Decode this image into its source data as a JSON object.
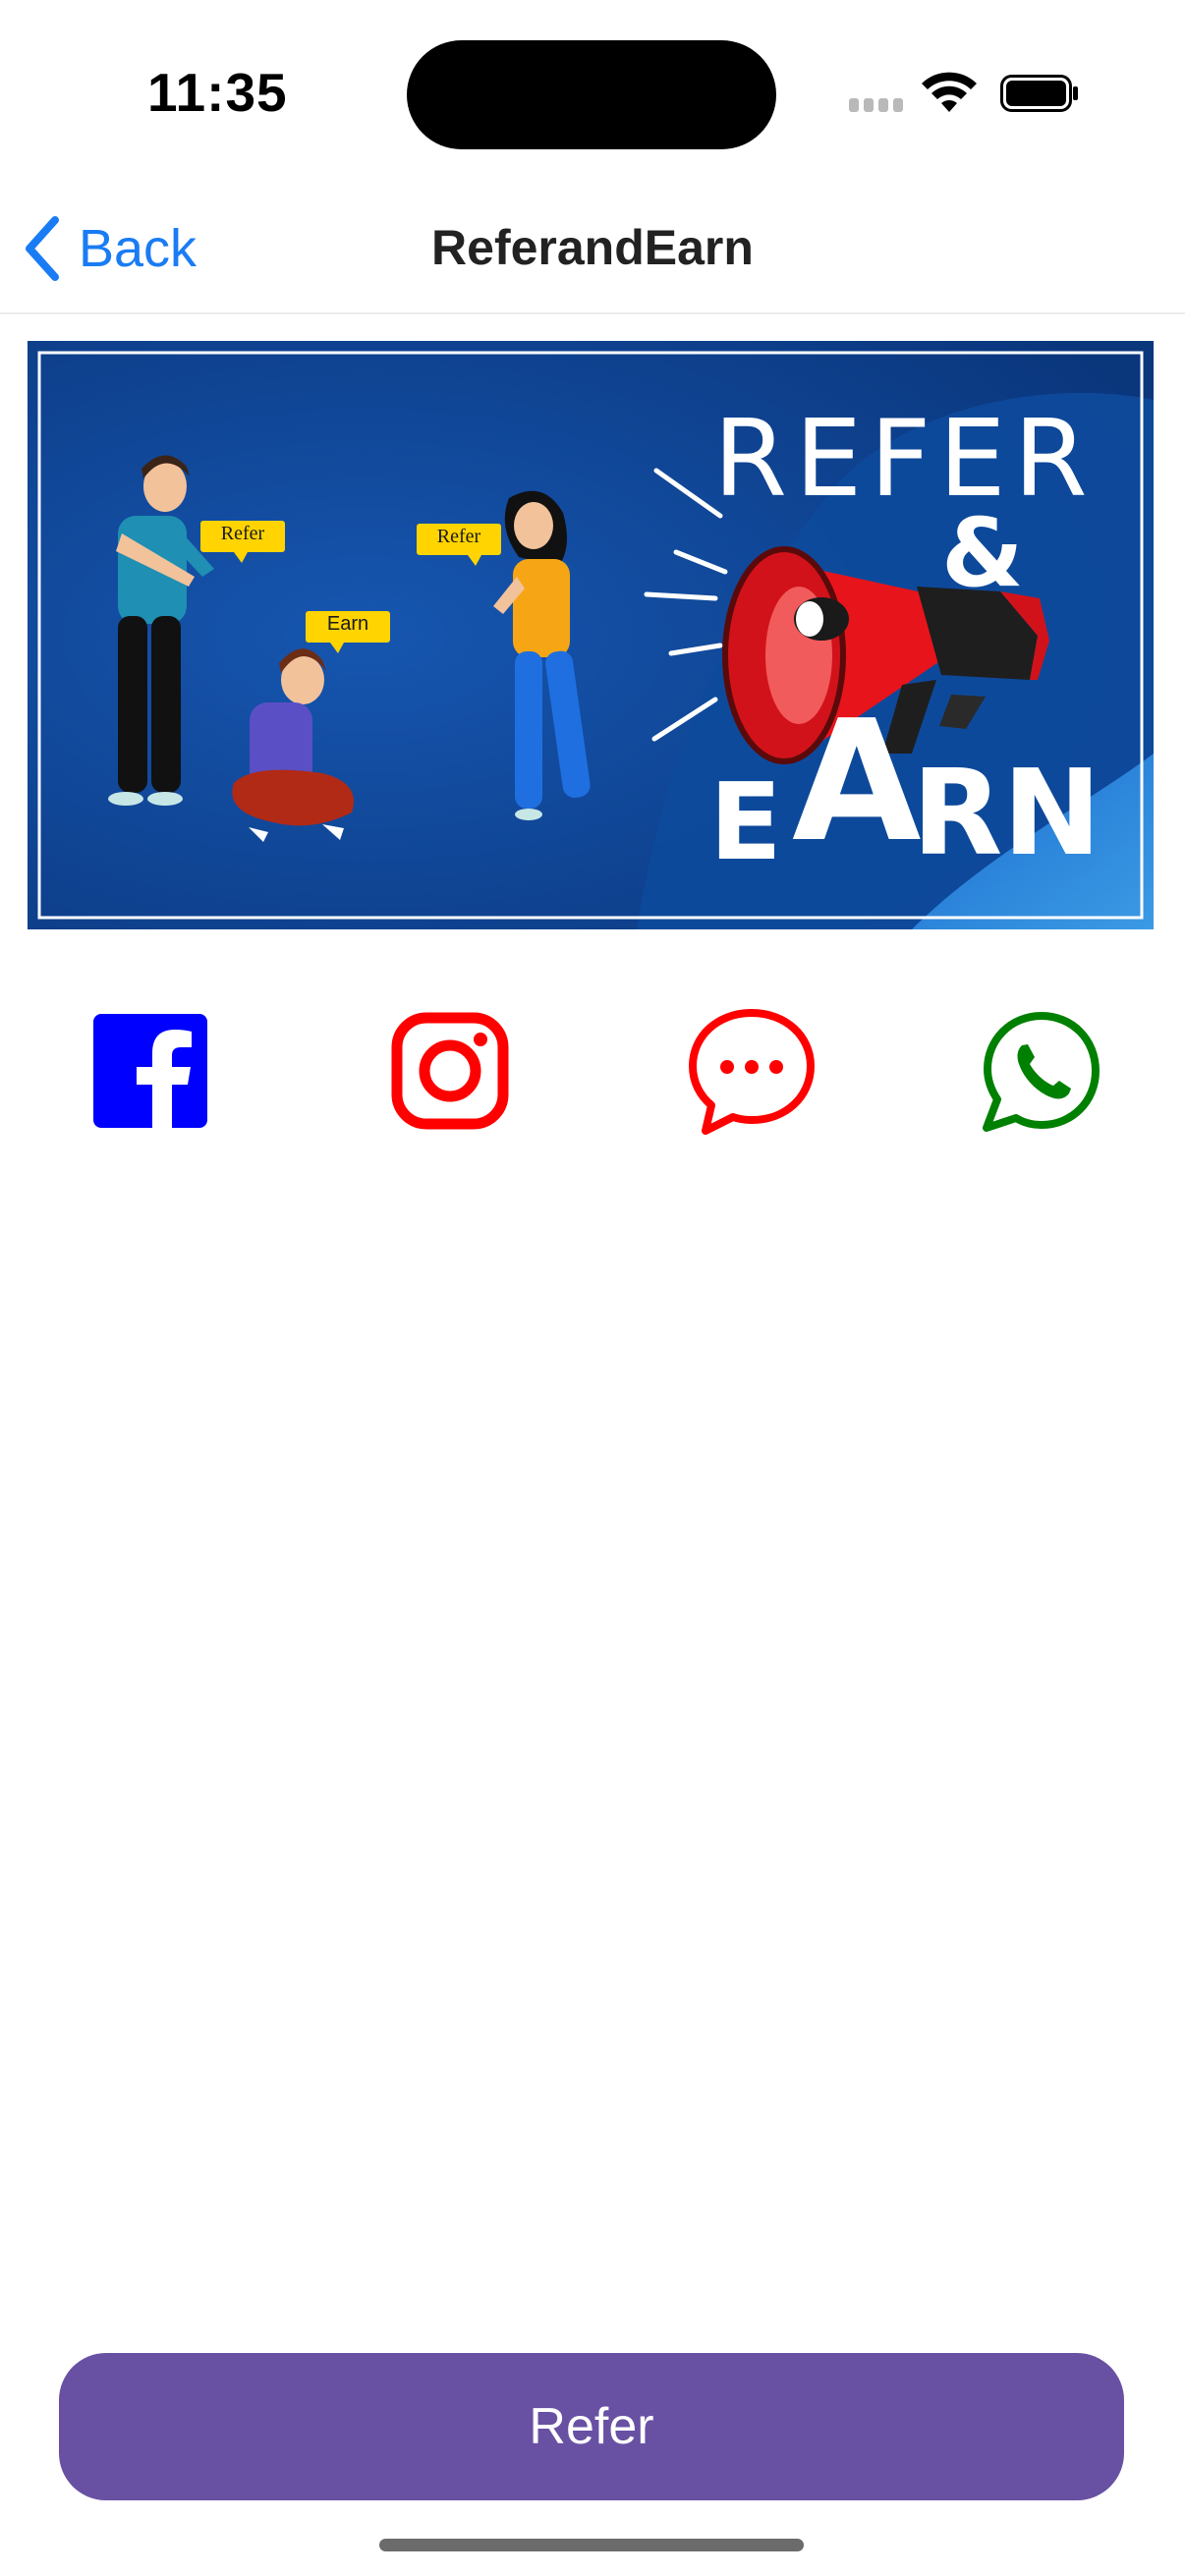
{
  "status_bar": {
    "time": "11:35"
  },
  "nav": {
    "back_label": "Back",
    "title": "ReferandEarn"
  },
  "banner": {
    "headline_top": "REFER",
    "headline_mid": "&",
    "headline_bottom_1": "E",
    "headline_bottom_2": "A",
    "headline_bottom_3": "RN",
    "bubble_1": "Refer",
    "bubble_2": "Earn",
    "bubble_3": "Refer"
  },
  "social_icons": [
    {
      "name": "facebook-icon",
      "color": "#0000ff"
    },
    {
      "name": "instagram-icon",
      "color": "#ff0000"
    },
    {
      "name": "message-icon",
      "color": "#ff0000"
    },
    {
      "name": "whatsapp-icon",
      "color": "#008000"
    }
  ],
  "footer": {
    "refer_label": "Refer"
  },
  "colors": {
    "accent": "#1a7cf5",
    "button": "#6850a3",
    "banner_bg": "#0b3f8e"
  }
}
